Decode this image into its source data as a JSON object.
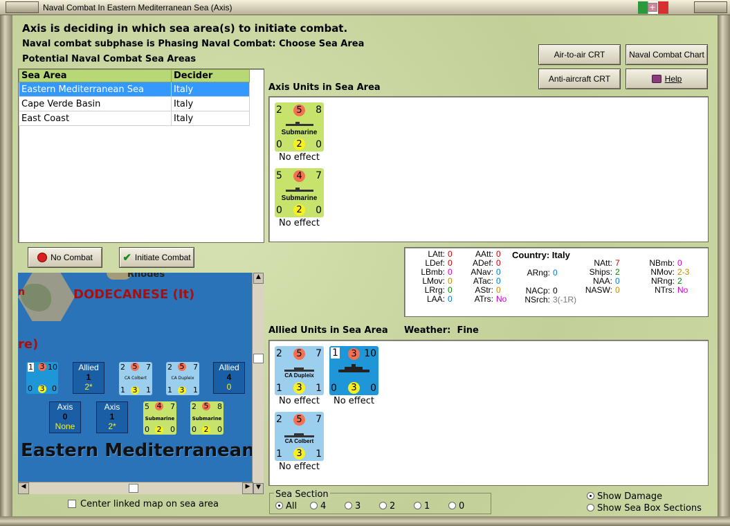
{
  "window": {
    "title": "Naval Combat In Eastern Mediterranean Sea (Axis)"
  },
  "header": {
    "status": "Axis is deciding in which sea area(s) to initiate combat.",
    "subphase": "Naval combat subphase is Phasing Naval Combat: Choose Sea Area",
    "potential_label": "Potential Naval Combat Sea Areas"
  },
  "sea_table": {
    "columns": [
      "Sea Area",
      "Decider"
    ],
    "rows": [
      {
        "area": "Eastern Mediterranean Sea",
        "decider": "Italy"
      },
      {
        "area": "Cape Verde Basin",
        "decider": "Italy"
      },
      {
        "area": "East Coast",
        "decider": "Italy"
      }
    ]
  },
  "buttons": {
    "air_crt": "Air-to-air CRT",
    "naval_chart": "Naval Combat Chart",
    "aa_crt": "Anti-aircraft CRT",
    "help": "Help",
    "no_combat": "No Combat",
    "initiate": "Initiate Combat"
  },
  "axis_panel": {
    "title": "Axis Units in Sea Area",
    "units": [
      {
        "left": "2",
        "mid": "5",
        "right": "8",
        "name": "Submarine",
        "bl": "0",
        "bm": "2",
        "br": "0",
        "effect": "No effect"
      },
      {
        "left": "5",
        "mid": "4",
        "right": "7",
        "name": "Submarine",
        "bl": "0",
        "bm": "2",
        "br": "0",
        "effect": "No effect"
      }
    ]
  },
  "stats": {
    "country_label": "Country:",
    "country": "Italy",
    "col1": [
      [
        "LAtt:",
        "0"
      ],
      [
        "LDef:",
        "0"
      ],
      [
        "LBmb:",
        "0"
      ],
      [
        "LMov:",
        "0"
      ],
      [
        "LRrg:",
        "0"
      ],
      [
        "LAA:",
        "0"
      ]
    ],
    "col2": [
      [
        "AAtt:",
        "0"
      ],
      [
        "ADef:",
        "0"
      ],
      [
        "ANav:",
        "0"
      ],
      [
        "ATac:",
        "0"
      ],
      [
        "AStr:",
        "0"
      ],
      [
        "ATrs:",
        "No"
      ]
    ],
    "col3": [
      [
        "ARng:",
        "0"
      ],
      [
        "NACp:",
        "0"
      ],
      [
        "NSrch:",
        "3(-1R)"
      ]
    ],
    "col4": [
      [
        "NAtt:",
        "7"
      ],
      [
        "Ships:",
        "2"
      ],
      [
        "NAA:",
        "0"
      ],
      [
        "NASW:",
        "0"
      ]
    ],
    "col5": [
      [
        "NBmb:",
        "0"
      ],
      [
        "NMov:",
        "2-3"
      ],
      [
        "NRng:",
        "2"
      ],
      [
        "NTrs:",
        "No"
      ]
    ]
  },
  "allied_panel": {
    "title": "Allied Units in Sea Area",
    "weather_label": "Weather:",
    "weather": "Fine",
    "units": [
      {
        "left": "2",
        "mid": "5",
        "right": "7",
        "name": "CA Dupleix",
        "bl": "1",
        "bm": "3",
        "br": "1",
        "effect": "No effect"
      },
      {
        "left": "1",
        "mid": "3",
        "right": "10",
        "name": "",
        "bl": "0",
        "bm": "3",
        "br": "0",
        "effect": "No effect"
      },
      {
        "left": "2",
        "mid": "5",
        "right": "7",
        "name": "CA Colbert",
        "bl": "1",
        "bm": "3",
        "br": "1",
        "effect": "No effect"
      }
    ]
  },
  "map": {
    "rhodes": "Rhodes",
    "dodecanese": "DODECANESE (It)",
    "re": "re)",
    "n": "n",
    "sea_name": "Eastern Mediterranean",
    "allied_box1": {
      "title": "Allied",
      "num": "1",
      "sub": "2*"
    },
    "allied_box2": {
      "title": "Allied",
      "num": "4",
      "sub": "0"
    },
    "axis_box1": {
      "title": "Axis",
      "num": "0",
      "sub": "None"
    },
    "axis_box2": {
      "title": "Axis",
      "num": "1",
      "sub": "2*"
    },
    "mini": [
      {
        "l": "1",
        "m": "3",
        "r": "10",
        "n": "",
        "bl": "0",
        "bm": "3",
        "br": "0"
      },
      {
        "l": "2",
        "m": "5",
        "r": "7",
        "n": "CA Colbert",
        "bl": "1",
        "bm": "3",
        "br": "1"
      },
      {
        "l": "2",
        "m": "5",
        "r": "7",
        "n": "CA Dupleix",
        "bl": "1",
        "bm": "3",
        "br": "1"
      },
      {
        "l": "5",
        "m": "4",
        "r": "7",
        "n": "Submarine",
        "bl": "0",
        "bm": "2",
        "br": "0"
      },
      {
        "l": "2",
        "m": "5",
        "r": "8",
        "n": "Submarine",
        "bl": "0",
        "bm": "2",
        "br": "0"
      }
    ],
    "center_label": "Center linked map on sea area"
  },
  "sea_section": {
    "label": "Sea Section",
    "options": [
      "All",
      "4",
      "3",
      "2",
      "1",
      "0"
    ],
    "selected": "All"
  },
  "display": {
    "show_damage": "Show Damage",
    "show_sections": "Show Sea Box Sections"
  },
  "colors": {
    "axis_counter": "#c6e46c",
    "allied_counter": "#9ccfee",
    "selection": "#3399ff"
  }
}
